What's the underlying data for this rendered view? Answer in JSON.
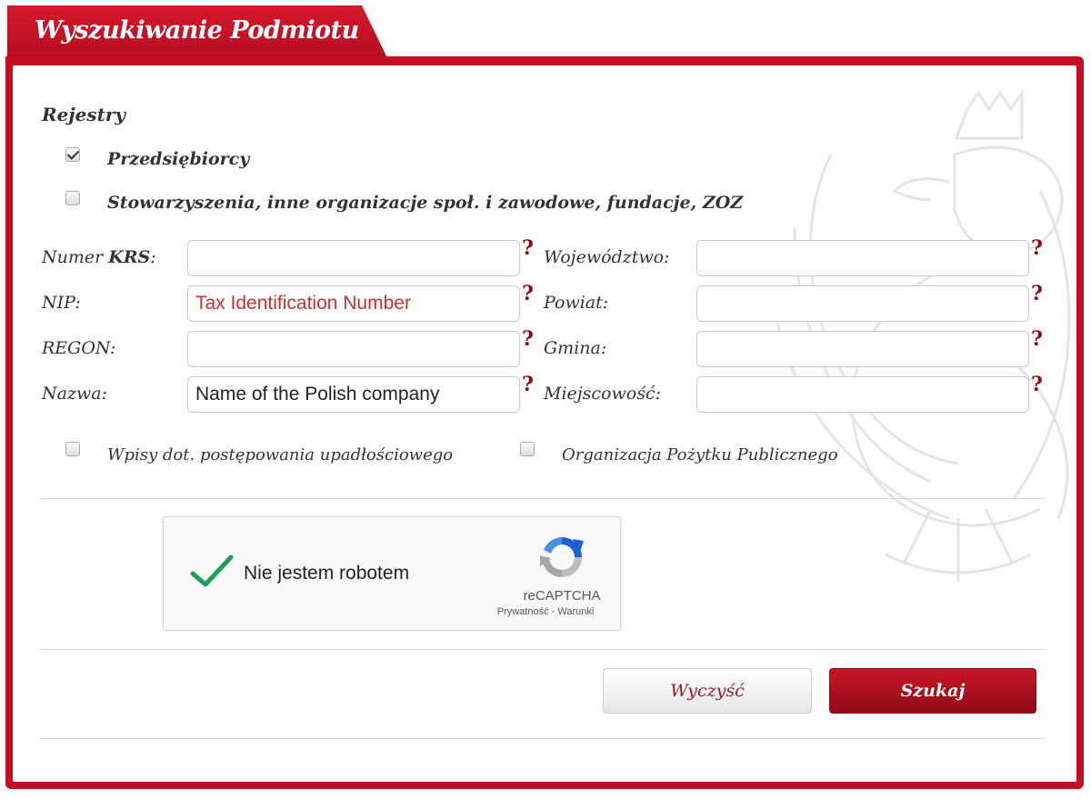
{
  "header": {
    "title": "Wyszukiwanie Podmiotu"
  },
  "registers": {
    "title": "Rejestry",
    "items": [
      {
        "label": "Przedsiębiorcy",
        "checked": true
      },
      {
        "label": "Stowarzyszenia, inne organizacje społ. i zawodowe, fundacje, ZOZ",
        "checked": false
      }
    ]
  },
  "fields": {
    "krs": {
      "label_prefix": "Numer ",
      "label_strong": "KRS",
      "label_suffix": ":",
      "value": ""
    },
    "nip": {
      "label": "NIP:",
      "value": "Tax Identification Number"
    },
    "regon": {
      "label": "REGON:",
      "value": ""
    },
    "nazwa": {
      "label": "Nazwa:",
      "value": "Name of the Polish company"
    },
    "wojewodztwo": {
      "label": "Województwo:",
      "value": ""
    },
    "powiat": {
      "label": "Powiat:",
      "value": ""
    },
    "gmina": {
      "label": "Gmina:",
      "value": ""
    },
    "miejscowosc": {
      "label": "Miejscowość:",
      "value": ""
    },
    "help_glyph": "?"
  },
  "options": {
    "bankruptcy": {
      "label": "Wpisy dot. postępowania upadłościowego",
      "checked": false
    },
    "opp": {
      "label": "Organizacja Pożytku Publicznego",
      "checked": false
    }
  },
  "captcha": {
    "text": "Nie jestem robotem",
    "brand": "reCAPTCHA",
    "links": "Prywatność - Warunki",
    "checked": true,
    "colors": {
      "check": "#1e9e57",
      "logo_blue": "#1c5fd8",
      "logo_light": "#4a90e2",
      "logo_gray": "#a6a6a6"
    }
  },
  "buttons": {
    "clear": "Wyczyść",
    "search": "Szukaj"
  },
  "colors": {
    "accent": "#c40e22",
    "help": "#8a0a14",
    "input_red_text": "#c9302c"
  }
}
